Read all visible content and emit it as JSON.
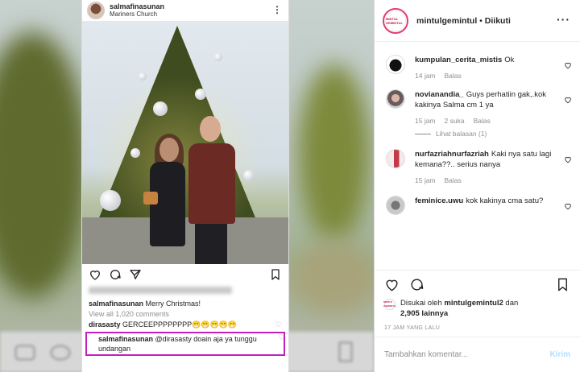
{
  "left_post": {
    "username": "salmafinasunan",
    "location": "Mariners Church",
    "caption_user": "salmafinasunan",
    "caption_text": "Merry Christmas!",
    "view_all": "View all 1,020 comments",
    "comment1_user": "dirasasty",
    "comment1_text": "GERCEEPPPPPPPP😁😁😁😁😁",
    "reply_user": "salmafinasunan",
    "reply_text": "@dirasasty doain aja ya tunggu",
    "reply_text2": "undangan"
  },
  "right_panel": {
    "account": "mintulgemintul",
    "separator": "•",
    "follow_state": "Diikuti",
    "logo_text": "MINTUL GEMINTUL",
    "comments": [
      {
        "user": "kumpulan_cerita_mistis",
        "text": "Ok",
        "time": "14 jam",
        "likes": "",
        "reply": "Balas"
      },
      {
        "user": "novianandia_",
        "text": "Guys perhatiin gak,.kok kakinya Salma cm 1 ya",
        "time": "15 jam",
        "likes": "2 suka",
        "reply": "Balas",
        "view_replies": "Lihat balasan (1)"
      },
      {
        "user": "nurfazriahnurfazriah",
        "text": "Kaki nya satu lagi kemana??.. serius nanya",
        "time": "15 jam",
        "likes": "",
        "reply": "Balas"
      },
      {
        "user": "feminice.uwu",
        "text": "kok kakinya cma satu?",
        "time": "",
        "likes": "",
        "reply": ""
      }
    ],
    "liked_prefix": "Disukai oleh",
    "liked_user": "mintulgemintul2",
    "liked_and": "dan",
    "liked_count": "2,905 lainnya",
    "timestamp": "17 JAM YANG LALU",
    "comment_placeholder": "Tambahkan komentar...",
    "send_label": "Kirim"
  },
  "colors": {
    "highlight": "#c21fc2",
    "story_ring": "#e03c6e",
    "send_disabled": "#b2dffc"
  }
}
